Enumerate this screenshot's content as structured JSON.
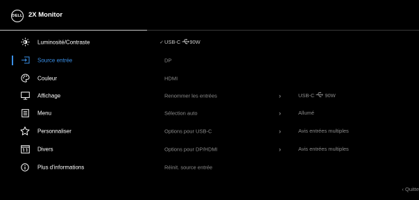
{
  "header": {
    "logo_text": "DELL",
    "title": "2X Monitor"
  },
  "sidebar": {
    "items": [
      {
        "label": "Luminosité/Contraste",
        "icon": "brightness-icon",
        "active": false
      },
      {
        "label": "Source entrée",
        "icon": "input-source-icon",
        "active": true
      },
      {
        "label": "Couleur",
        "icon": "color-palette-icon",
        "active": false
      },
      {
        "label": "Affichage",
        "icon": "display-monitor-icon",
        "active": false
      },
      {
        "label": "Menu",
        "icon": "menu-document-icon",
        "active": false
      },
      {
        "label": "Personnaliser",
        "icon": "star-icon",
        "active": false
      },
      {
        "label": "Divers",
        "icon": "misc-info-icon",
        "active": false
      },
      {
        "label": "Plus d'informations",
        "icon": "info-circle-icon",
        "active": false
      }
    ]
  },
  "sources": {
    "items": [
      {
        "label": "USB-C",
        "power": "90W",
        "selected": true
      },
      {
        "label": "DP"
      },
      {
        "label": "HDMI"
      },
      {
        "label": "Renommer les entrées",
        "has_submenu": true
      },
      {
        "label": "Sélection auto",
        "has_submenu": true
      },
      {
        "label": "Options pour USB-C",
        "has_submenu": true
      },
      {
        "label": "Options pour DP/HDMI",
        "has_submenu": true
      },
      {
        "label": "Réinit. source entrée"
      }
    ]
  },
  "values": {
    "rename_value": "USB-C",
    "rename_power": "90W",
    "auto_select_value": "Allumé",
    "usbc_options_value": "Avis entrées multiples",
    "dphdmi_options_value": "Avis entrées multiples"
  },
  "footer": {
    "quit_label": "Quitte"
  },
  "colors": {
    "accent": "#3a8fe6",
    "background": "#000000",
    "text_primary": "#ffffff",
    "text_secondary": "#8c8c8c"
  }
}
